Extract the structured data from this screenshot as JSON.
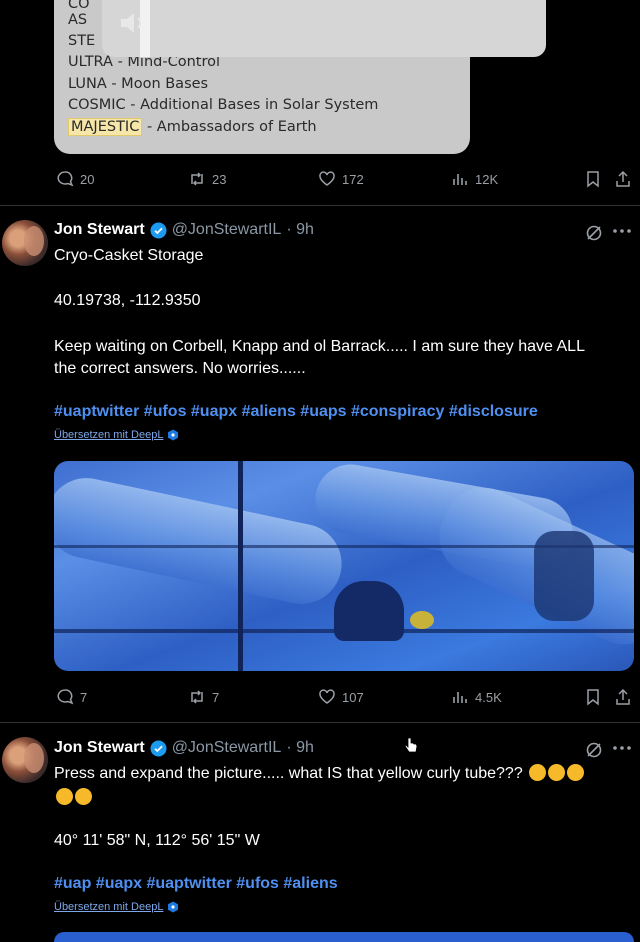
{
  "quoted_card": {
    "lines": [
      "CO",
      "AS",
      "STE",
      "ULTRA - Mind-Control",
      "LUNA - Moon Bases",
      "COSMIC - Additional Bases in Solar System"
    ],
    "highlight": "MAJESTIC",
    "highlight_rest": " - Ambassadors of Earth"
  },
  "first_tweet_actions": {
    "replies": "20",
    "reposts": "23",
    "likes": "172",
    "views": "12K"
  },
  "tweets": [
    {
      "name": "Jon Stewart",
      "handle": "@JonStewartIL",
      "time": "· 9h",
      "lines": [
        "Cryo-Casket Storage",
        "40.19738, -112.9350",
        "Keep waiting on Corbell, Knapp and ol Barrack..... I am sure they have ALL",
        "the correct answers. No worries......"
      ],
      "hashtags": "#uaptwitter #ufos #uapx #aliens #uaps #conspiracy #disclosure",
      "translate": "Übersetzen mit DeepL",
      "actions": {
        "replies": "7",
        "reposts": "7",
        "likes": "107",
        "views": "4.5K"
      }
    },
    {
      "name": "Jon Stewart",
      "handle": "@JonStewartIL",
      "time": "· 9h",
      "lines": [
        "Press and expand the picture..... what IS that yellow curly tube???",
        "40° 11' 58\" N, 112° 56' 15\" W"
      ],
      "hashtags": "#uap #uapx #uaptwitter #ufos #aliens",
      "translate": "Übersetzen mit DeepL"
    }
  ],
  "colors": {
    "background": "#000000",
    "link": "#4f8ff0",
    "verified": "#1d9bf0",
    "muted": "#8b98a5"
  }
}
